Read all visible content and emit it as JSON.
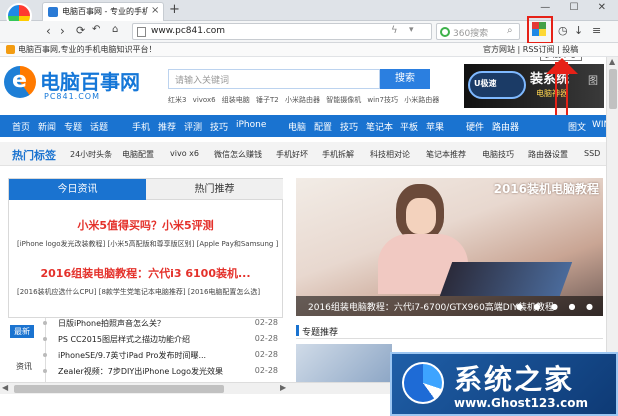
{
  "browser": {
    "tab_title": "电脑百事网 - 专业的手机电脑",
    "new_tab": "+",
    "window_controls": "—  ☐  ✕",
    "url": "www.pc841.com",
    "search_placeholder": "360搜索",
    "tooltip": "扩展中心",
    "favorites_left": "电脑百事网,专业的手机电脑知识平台！",
    "favorites_right": "官方网站 | RSS订阅 | 投稿"
  },
  "site": {
    "logo_cn": "电脑百事网",
    "logo_en": "PC841.COM",
    "search_placeholder": "请输入关键词",
    "search_button": "搜索",
    "hotwords": "红米3 vivox6 组装电脑 锤子T2 小米路由器 智能摄像机 win7技巧 小米路由器",
    "banner_brand": "U极速",
    "banner_title": "装系统",
    "banner_sub": "电脑神器",
    "banner_right": "图"
  },
  "nav": [
    {
      "label": "首页"
    },
    {
      "label": "新闻"
    },
    {
      "label": "专题"
    },
    {
      "label": "话题"
    },
    {
      "label": "手机"
    },
    {
      "label": "推荐"
    },
    {
      "label": "评测"
    },
    {
      "label": "技巧"
    },
    {
      "label": "iPhone"
    },
    {
      "label": "电脑"
    },
    {
      "label": "配置"
    },
    {
      "label": "技巧"
    },
    {
      "label": "笔记本"
    },
    {
      "label": "平板"
    },
    {
      "label": "苹果"
    },
    {
      "label": "硬件"
    },
    {
      "label": "路由器"
    },
    {
      "label": "图文"
    },
    {
      "label": "WIN"
    }
  ],
  "hottags": {
    "label": "热门标签",
    "tags": [
      "24小时头条",
      "电脑配置",
      "vivo x6",
      "微信怎么赚钱",
      "手机好坏",
      "手机拆解",
      "科技相对论",
      "笔记本推荐",
      "电脑技巧",
      "路由器设置",
      "SSD"
    ]
  },
  "left": {
    "tab_today": "今日资讯",
    "tab_hot": "热门推荐",
    "headline1": "小米5值得买吗？小米5评测",
    "sub1": "[iPhone logo发光改装教程]  [小米5高配版和尊享版区别]  [Apple Pay和Samsung ]",
    "headline2": "2016组装电脑教程：六代i3 6100装机...",
    "sub2": "[2016装机应选什么CPU]  [8款学生党笔记本电脑推荐]  [2016电脑配置怎么选]",
    "latest_badge": "最新",
    "info_label": "资讯",
    "list": [
      {
        "title": "日版iPhone拍照声音怎么关？",
        "date": "02-28"
      },
      {
        "title": "PS CC2015图层样式之描边功能介绍",
        "date": "02-28"
      },
      {
        "title": "iPhoneSE/9.7英寸iPad Pro发布时间曝...",
        "date": "02-28"
      },
      {
        "title": "Zealer视频：7步DIY出iPhone Logo发光效果",
        "date": "02-28"
      }
    ]
  },
  "carousel": {
    "title": "2016装机电脑教程",
    "caption": "2016组装电脑教程：六代i7-6700/GTX960高端DIY装机教程",
    "dots": "● ● ● ● ●"
  },
  "topic": {
    "label": "专题推荐"
  },
  "watermark": {
    "title": "系统之家",
    "url": "www.Ghost123.com"
  }
}
